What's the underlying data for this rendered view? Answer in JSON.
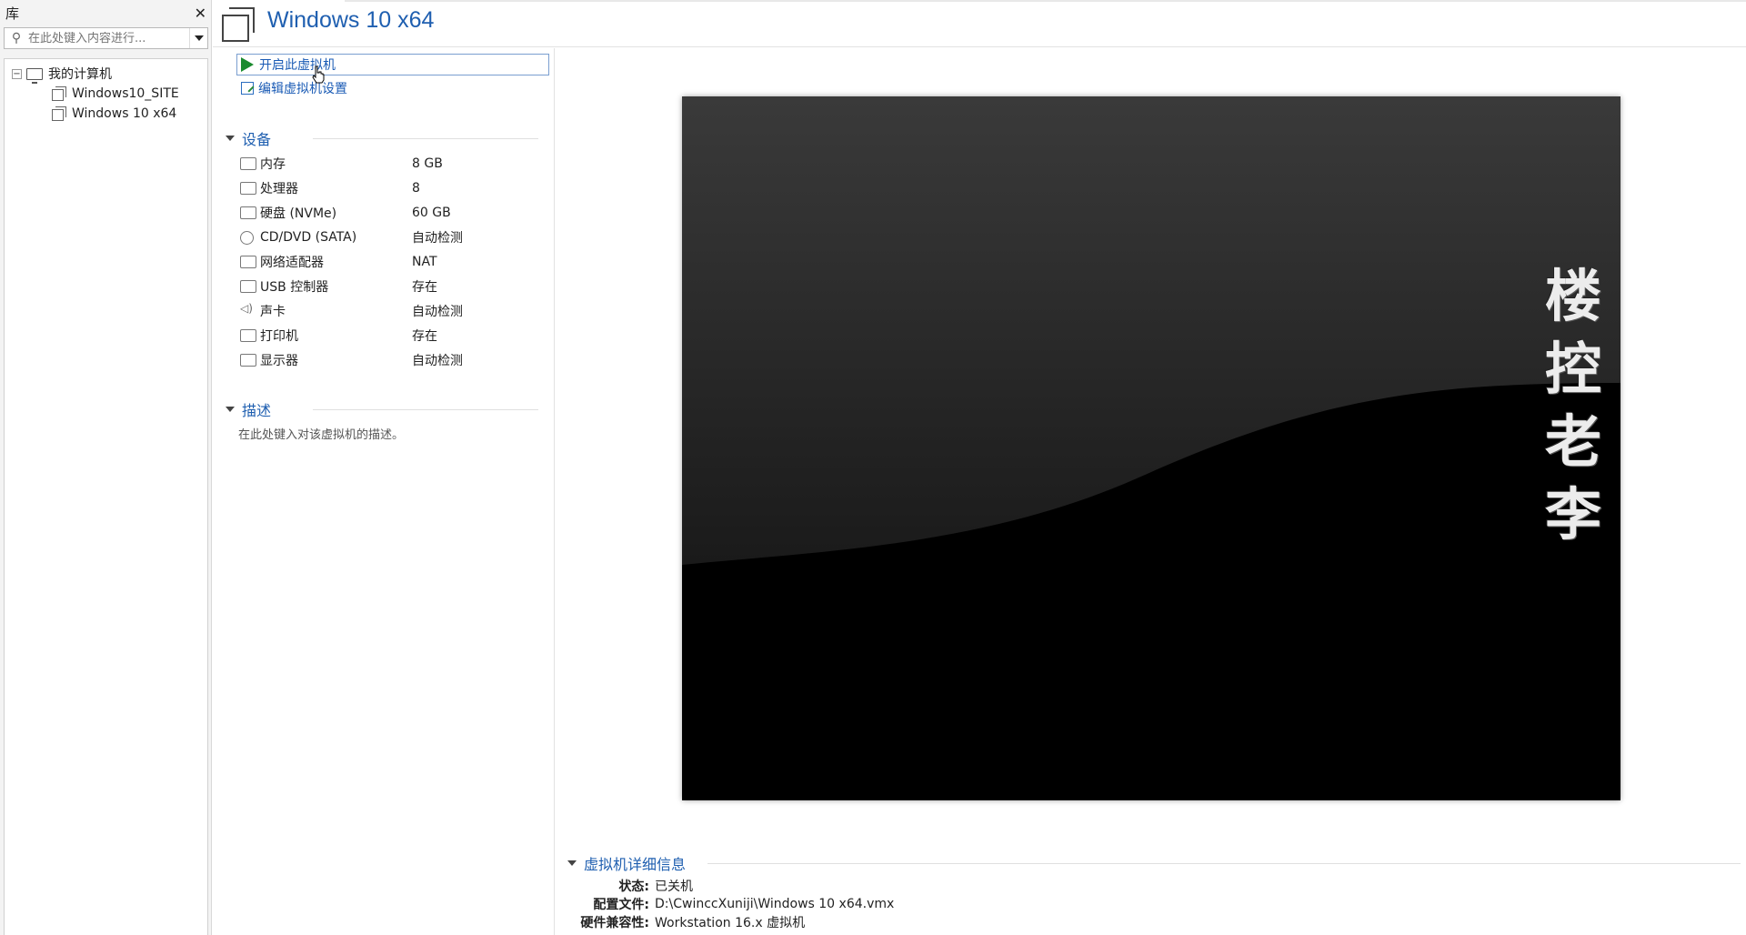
{
  "library": {
    "title": "库",
    "close": "✕",
    "search_placeholder": "在此处键入内容进行...",
    "tree": {
      "root": "我的计算机",
      "expander": "−",
      "items": [
        "Windows10_SITE",
        "Windows 10 x64"
      ]
    }
  },
  "title": "Windows 10 x64",
  "actions": {
    "power_on": "开启此虚拟机",
    "edit_settings": "编辑虚拟机设置"
  },
  "devices": {
    "heading": "设备",
    "rows": [
      {
        "icon": "memory-icon",
        "name": "内存",
        "value": "8 GB"
      },
      {
        "icon": "processor-icon",
        "name": "处理器",
        "value": "8"
      },
      {
        "icon": "disk-icon",
        "name": "硬盘 (NVMe)",
        "value": "60 GB"
      },
      {
        "icon": "cd-dvd-icon",
        "name": "CD/DVD (SATA)",
        "value": "自动检测"
      },
      {
        "icon": "network-icon",
        "name": "网络适配器",
        "value": "NAT"
      },
      {
        "icon": "usb-icon",
        "name": "USB 控制器",
        "value": "存在"
      },
      {
        "icon": "sound-icon",
        "name": "声卡",
        "value": "自动检测"
      },
      {
        "icon": "printer-icon",
        "name": "打印机",
        "value": "存在"
      },
      {
        "icon": "display-icon",
        "name": "显示器",
        "value": "自动检测"
      }
    ]
  },
  "description": {
    "heading": "描述",
    "placeholder": "在此处键入对该虚拟机的描述。"
  },
  "preview": {
    "watermark": [
      "楼",
      "控",
      "老",
      "李"
    ]
  },
  "details": {
    "heading": "虚拟机详细信息",
    "rows": [
      {
        "key": "状态:",
        "value": "已关机"
      },
      {
        "key": "配置文件:",
        "value": "D:\\CwinccXuniji\\Windows 10 x64.vmx"
      },
      {
        "key": "硬件兼容性:",
        "value": "Workstation 16.x 虚拟机"
      }
    ]
  },
  "colors": {
    "accent": "#1f5fb0",
    "play_green": "#1a8a2e"
  }
}
